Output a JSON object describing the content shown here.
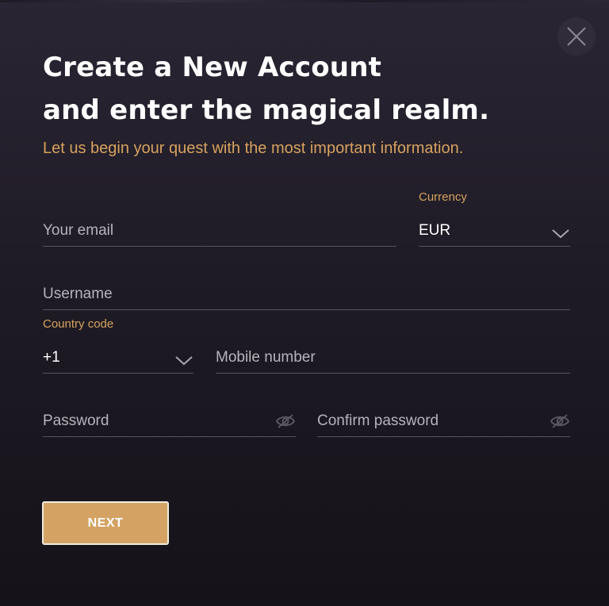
{
  "header": {
    "title_line1": "Create a New Account",
    "title_line2": "and enter the magical realm.",
    "subtitle": "Let us begin your quest with the most important information."
  },
  "close": {
    "icon": "close-icon"
  },
  "form": {
    "email": {
      "placeholder": "Your email"
    },
    "currency": {
      "label": "Currency",
      "value": "EUR",
      "icon": "chevron-down-icon"
    },
    "username": {
      "placeholder": "Username"
    },
    "country_code": {
      "label": "Country code",
      "value": "+1",
      "icon": "chevron-down-icon"
    },
    "mobile": {
      "placeholder": "Mobile number"
    },
    "password": {
      "placeholder": "Password",
      "icon": "eye-off-icon"
    },
    "confirm_password": {
      "placeholder": "Confirm password",
      "icon": "eye-off-icon"
    }
  },
  "actions": {
    "next_label": "NEXT"
  },
  "colors": {
    "accent": "#d7a25f",
    "button_bg": "#d4a364",
    "background": "#1f1b26",
    "field_line": "#57525e",
    "placeholder_text": "#b7b3bc"
  }
}
